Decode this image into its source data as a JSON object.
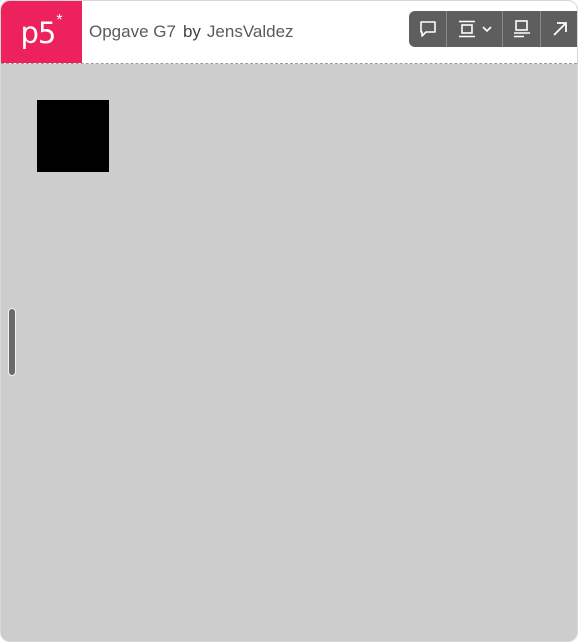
{
  "header": {
    "logo_text": "p5",
    "logo_star": "*",
    "sketch_title": "Opgave G7",
    "by_label": "by",
    "author": "JensValdez"
  },
  "toolbar": {
    "buttons": [
      {
        "icon": "comment-icon"
      },
      {
        "icon": "frame-layout-icon",
        "has_dropdown": true
      },
      {
        "icon": "code-view-icon"
      },
      {
        "icon": "open-external-icon"
      }
    ]
  },
  "canvas": {
    "background": "#cdcdcd",
    "square_color": "#000000"
  },
  "colors": {
    "brand": "#ed225d",
    "toolbar": "#5e5e5e"
  }
}
